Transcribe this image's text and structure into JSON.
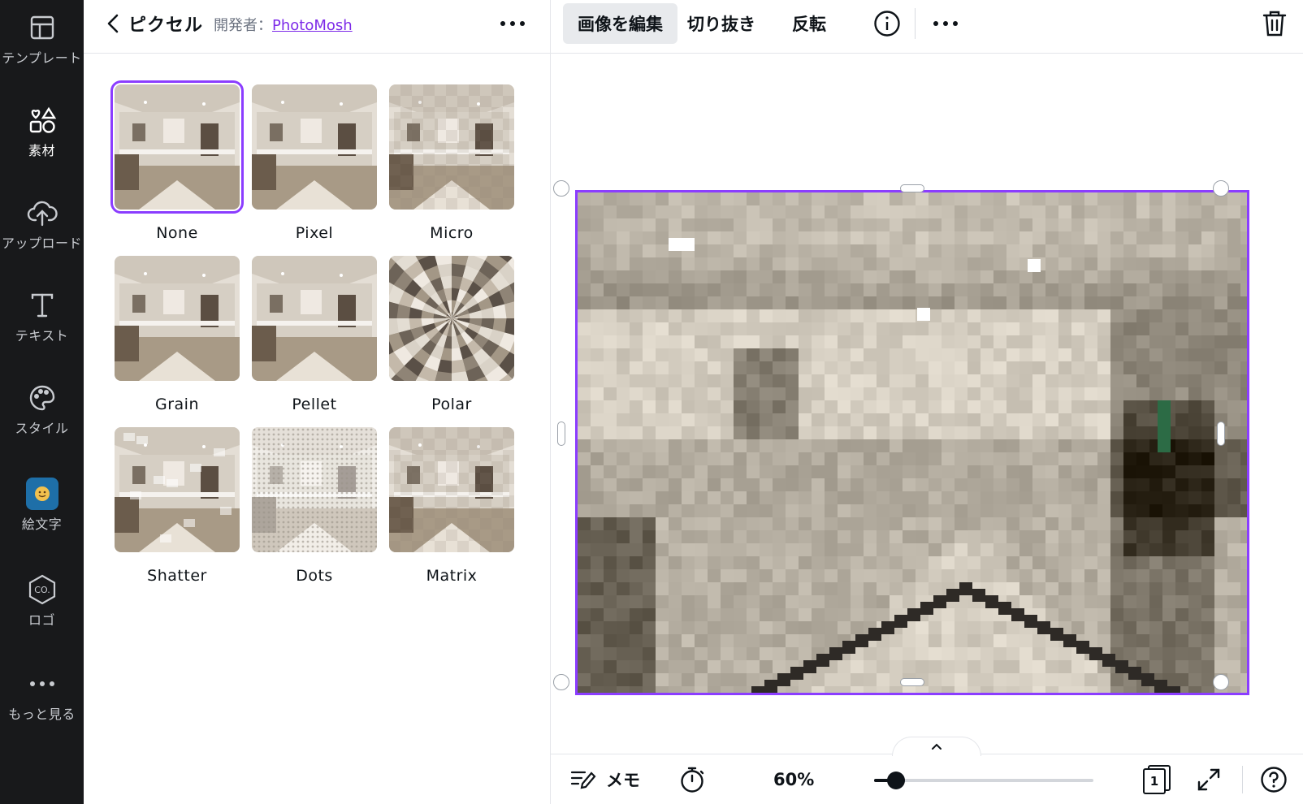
{
  "rail": {
    "items": [
      {
        "label": "テンプレート",
        "icon": "layout-icon"
      },
      {
        "label": "素材",
        "icon": "shapes-icon"
      },
      {
        "label": "アップロード",
        "icon": "cloud-upload-icon"
      },
      {
        "label": "テキスト",
        "icon": "text-icon"
      },
      {
        "label": "スタイル",
        "icon": "palette-icon"
      },
      {
        "label": "絵文字",
        "icon": "emoji-app-icon"
      },
      {
        "label": "ロゴ",
        "icon": "logo-co-icon"
      },
      {
        "label": "もっと見る",
        "icon": "more-dots-icon"
      }
    ],
    "active": "素材"
  },
  "panel": {
    "title": "ピクセル",
    "developer_prefix": "開発者：",
    "developer_name": "PhotoMosh",
    "effects": [
      "None",
      "Pixel",
      "Micro",
      "Grain",
      "Pellet",
      "Polar",
      "Shatter",
      "Dots",
      "Matrix"
    ],
    "selected_effect": "None"
  },
  "toolbar": {
    "edit_image": "画像を編集",
    "crop": "切り抜き",
    "flip": "反転"
  },
  "bottombar": {
    "notes": "メモ",
    "zoom": "60%",
    "zoom_fraction": 0.1,
    "page_count": "1"
  },
  "colors": {
    "accent": "#8b3dff",
    "rail_bg": "#18191b"
  }
}
